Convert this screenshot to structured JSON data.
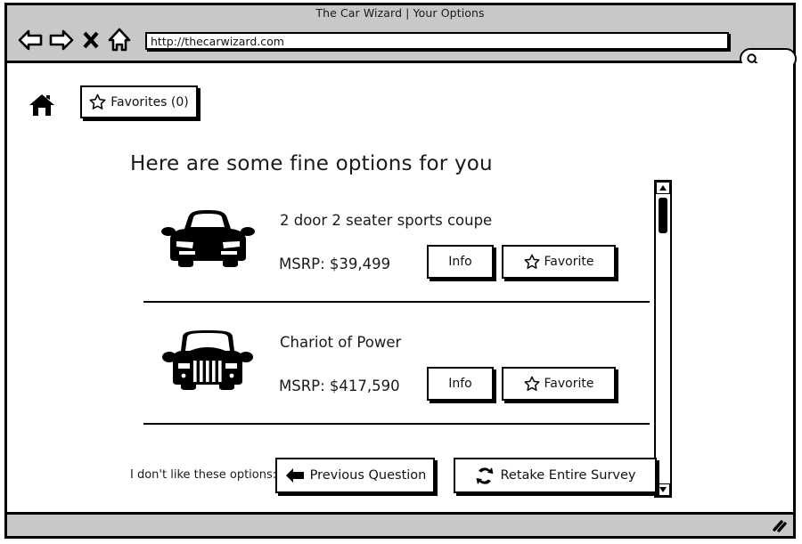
{
  "window": {
    "title": "The Car Wizard | Your Options"
  },
  "browser": {
    "back_icon": "back-arrow-icon",
    "forward_icon": "forward-arrow-icon",
    "stop_icon": "close-x-icon",
    "home_icon": "home-icon",
    "url_value": "http://thecarwizard.com",
    "url_placeholder": "Enter address",
    "search_icon": "search-icon",
    "search_value": "",
    "search_placeholder": ""
  },
  "header": {
    "home_icon": "home-icon",
    "favorites_icon": "star-icon",
    "favorites_label": "Favorites (0)"
  },
  "main": {
    "headline": "Here are some fine options for you",
    "cars": [
      {
        "thumb_icon": "sports-car-icon",
        "title": "2 door 2 seater sports coupe",
        "price": "MSRP: $39,499",
        "info_label": "Info",
        "favorite_icon": "star-icon",
        "favorite_label": "Favorite"
      },
      {
        "thumb_icon": "jeep-car-icon",
        "title": "Chariot of Power",
        "price": "MSRP: $417,590",
        "info_label": "Info",
        "favorite_icon": "star-icon",
        "favorite_label": "Favorite"
      }
    ]
  },
  "scrollbar": {
    "up_icon": "triangle-up-icon",
    "down_icon": "triangle-down-icon",
    "thumb_position_percent": 5
  },
  "footer": {
    "label": "I don't like these options:",
    "previous_icon": "left-arrow-icon",
    "previous_label": "Previous Question",
    "retake_icon": "refresh-icon",
    "retake_label": "Retake Entire Survey"
  },
  "statusbar": {
    "resize_icon": "resize-grip-icon"
  },
  "colors": {
    "chrome": "#c8c8c8",
    "ink": "#000000",
    "page": "#ffffff"
  }
}
